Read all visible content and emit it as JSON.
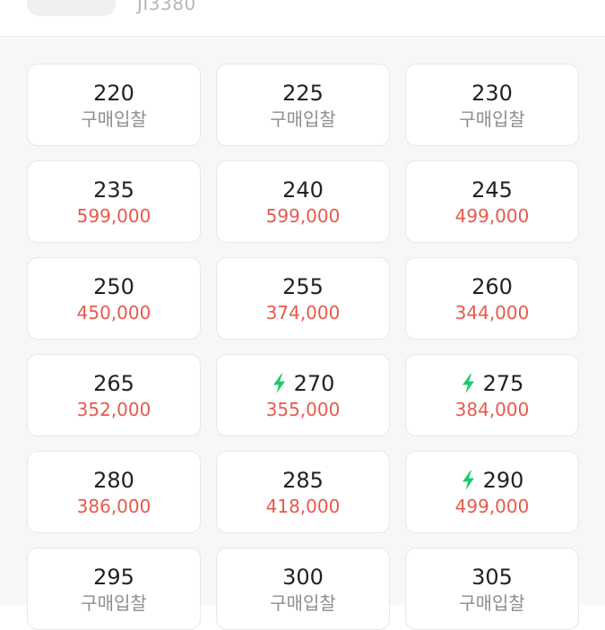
{
  "header": {
    "product_code": "JI3380"
  },
  "colors": {
    "price": "#e8594c",
    "bid_label": "#8e8e8e",
    "fast_delivery": "#1ccb6b"
  },
  "sizes": [
    {
      "size": "220",
      "sub": "구매입찰",
      "type": "bid",
      "fast": false
    },
    {
      "size": "225",
      "sub": "구매입찰",
      "type": "bid",
      "fast": false
    },
    {
      "size": "230",
      "sub": "구매입찰",
      "type": "bid",
      "fast": false
    },
    {
      "size": "235",
      "sub": "599,000",
      "type": "price",
      "fast": false
    },
    {
      "size": "240",
      "sub": "599,000",
      "type": "price",
      "fast": false
    },
    {
      "size": "245",
      "sub": "499,000",
      "type": "price",
      "fast": false
    },
    {
      "size": "250",
      "sub": "450,000",
      "type": "price",
      "fast": false
    },
    {
      "size": "255",
      "sub": "374,000",
      "type": "price",
      "fast": false
    },
    {
      "size": "260",
      "sub": "344,000",
      "type": "price",
      "fast": false
    },
    {
      "size": "265",
      "sub": "352,000",
      "type": "price",
      "fast": false
    },
    {
      "size": "270",
      "sub": "355,000",
      "type": "price",
      "fast": true,
      "fast_icon": "lightning-bolt-icon"
    },
    {
      "size": "275",
      "sub": "384,000",
      "type": "price",
      "fast": true,
      "fast_icon": "lightning-bolt-icon"
    },
    {
      "size": "280",
      "sub": "386,000",
      "type": "price",
      "fast": false
    },
    {
      "size": "285",
      "sub": "418,000",
      "type": "price",
      "fast": false
    },
    {
      "size": "290",
      "sub": "499,000",
      "type": "price",
      "fast": true,
      "fast_icon": "lightning-bolt-icon"
    },
    {
      "size": "295",
      "sub": "구매입찰",
      "type": "bid",
      "fast": false
    },
    {
      "size": "300",
      "sub": "구매입찰",
      "type": "bid",
      "fast": false
    },
    {
      "size": "305",
      "sub": "구매입찰",
      "type": "bid",
      "fast": false
    }
  ]
}
